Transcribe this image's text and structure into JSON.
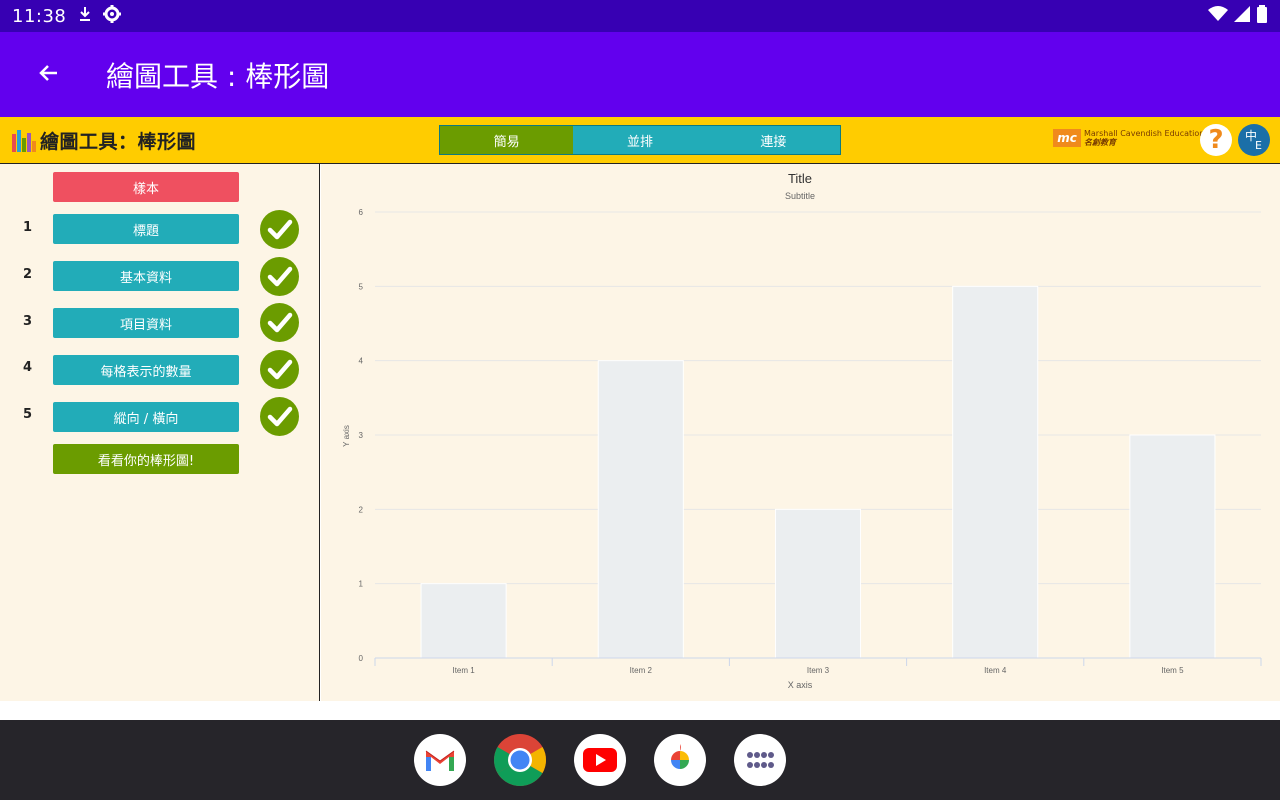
{
  "status_bar": {
    "time": "11:38"
  },
  "app_bar": {
    "title": "繪圖工具 : 棒形圖"
  },
  "header": {
    "tool_title": "繪圖工具：棒形圖",
    "tabs": [
      {
        "label": "簡易",
        "active": true
      },
      {
        "label": "並排",
        "active": false
      },
      {
        "label": "連接",
        "active": false
      }
    ],
    "brand_mark": "mc",
    "brand_line1": "Marshall Cavendish Education",
    "brand_line2": "名創教育",
    "help_label": "?",
    "lang_zh": "中",
    "lang_en": "E"
  },
  "sidebar": {
    "sample_label": "樣本",
    "steps": [
      {
        "num": "1",
        "label": "標題",
        "done": true
      },
      {
        "num": "2",
        "label": "基本資料",
        "done": true
      },
      {
        "num": "3",
        "label": "項目資料",
        "done": true
      },
      {
        "num": "4",
        "label": "每格表示的數量",
        "done": true
      },
      {
        "num": "5",
        "label": "縱向 / 橫向",
        "done": true
      }
    ],
    "view_label": "看看你的棒形圖!"
  },
  "chart_data": {
    "type": "bar",
    "title": "Title",
    "subtitle": "Subtitle",
    "xlabel": "X axis",
    "ylabel": "Y axis",
    "categories": [
      "Item 1",
      "Item 2",
      "Item 3",
      "Item 4",
      "Item 5"
    ],
    "values": [
      1,
      4,
      2,
      5,
      3
    ],
    "ylim": [
      0,
      6
    ],
    "yticks": [
      "0",
      "1",
      "2",
      "3",
      "4",
      "5",
      "6"
    ],
    "grid": true,
    "bar_color": "#ebeef0"
  },
  "dock": {
    "apps": [
      {
        "name": "gmail-icon"
      },
      {
        "name": "chrome-icon"
      },
      {
        "name": "youtube-icon"
      },
      {
        "name": "photos-icon"
      },
      {
        "name": "app-drawer-icon"
      }
    ]
  },
  "colors": {
    "status_bar": "#3700b3",
    "app_bar": "#6200ee",
    "header": "#ffcc00",
    "teal": "#22acb8",
    "green": "#6b9c00",
    "red": "#ef5060",
    "panel_bg": "#fdf5e6"
  }
}
